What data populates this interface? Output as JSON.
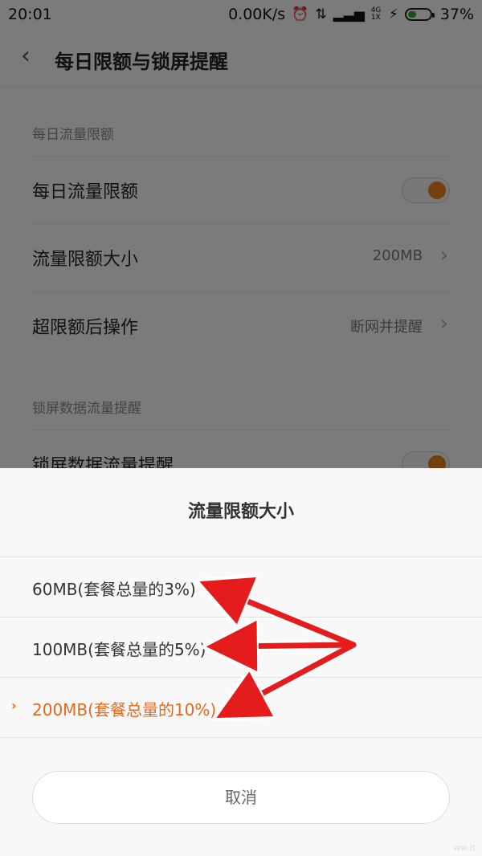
{
  "status_bar": {
    "time": "20:01",
    "net_speed": "0.00K/s",
    "battery_percent": "37%",
    "battery_level": 0.37,
    "icons": [
      "alarm-icon",
      "data-arrows-icon",
      "signal-icon",
      "network-type-icon",
      "charging-icon",
      "battery-icon"
    ],
    "network_type": "4G 1X"
  },
  "header": {
    "title": "每日限额与锁屏提醒",
    "back_icon": "back-chevron-icon"
  },
  "settings": {
    "section1": "每日流量限额",
    "daily_limit": {
      "label": "每日流量限额",
      "toggle_on": true
    },
    "limit_size": {
      "label": "流量限额大小",
      "value": "200MB"
    },
    "over_action": {
      "label": "超限额后操作",
      "value": "断网并提醒"
    },
    "section2": "锁屏数据流量提醒",
    "lockscreen": {
      "label": "锁屏数据流量提醒",
      "toggle_on": true
    }
  },
  "dialog": {
    "title": "流量限额大小",
    "options": [
      {
        "label": "60MB(套餐总量的3%)",
        "selected": false
      },
      {
        "label": "100MB(套餐总量的5%)",
        "selected": false
      },
      {
        "label": "200MB(套餐总量的10%)",
        "selected": true
      }
    ],
    "selected_marker": "›",
    "cancel": "取消"
  },
  "colors": {
    "accent": "#e8671b",
    "annotation_arrow": "#e51c1c"
  },
  "watermark": "ww.it"
}
